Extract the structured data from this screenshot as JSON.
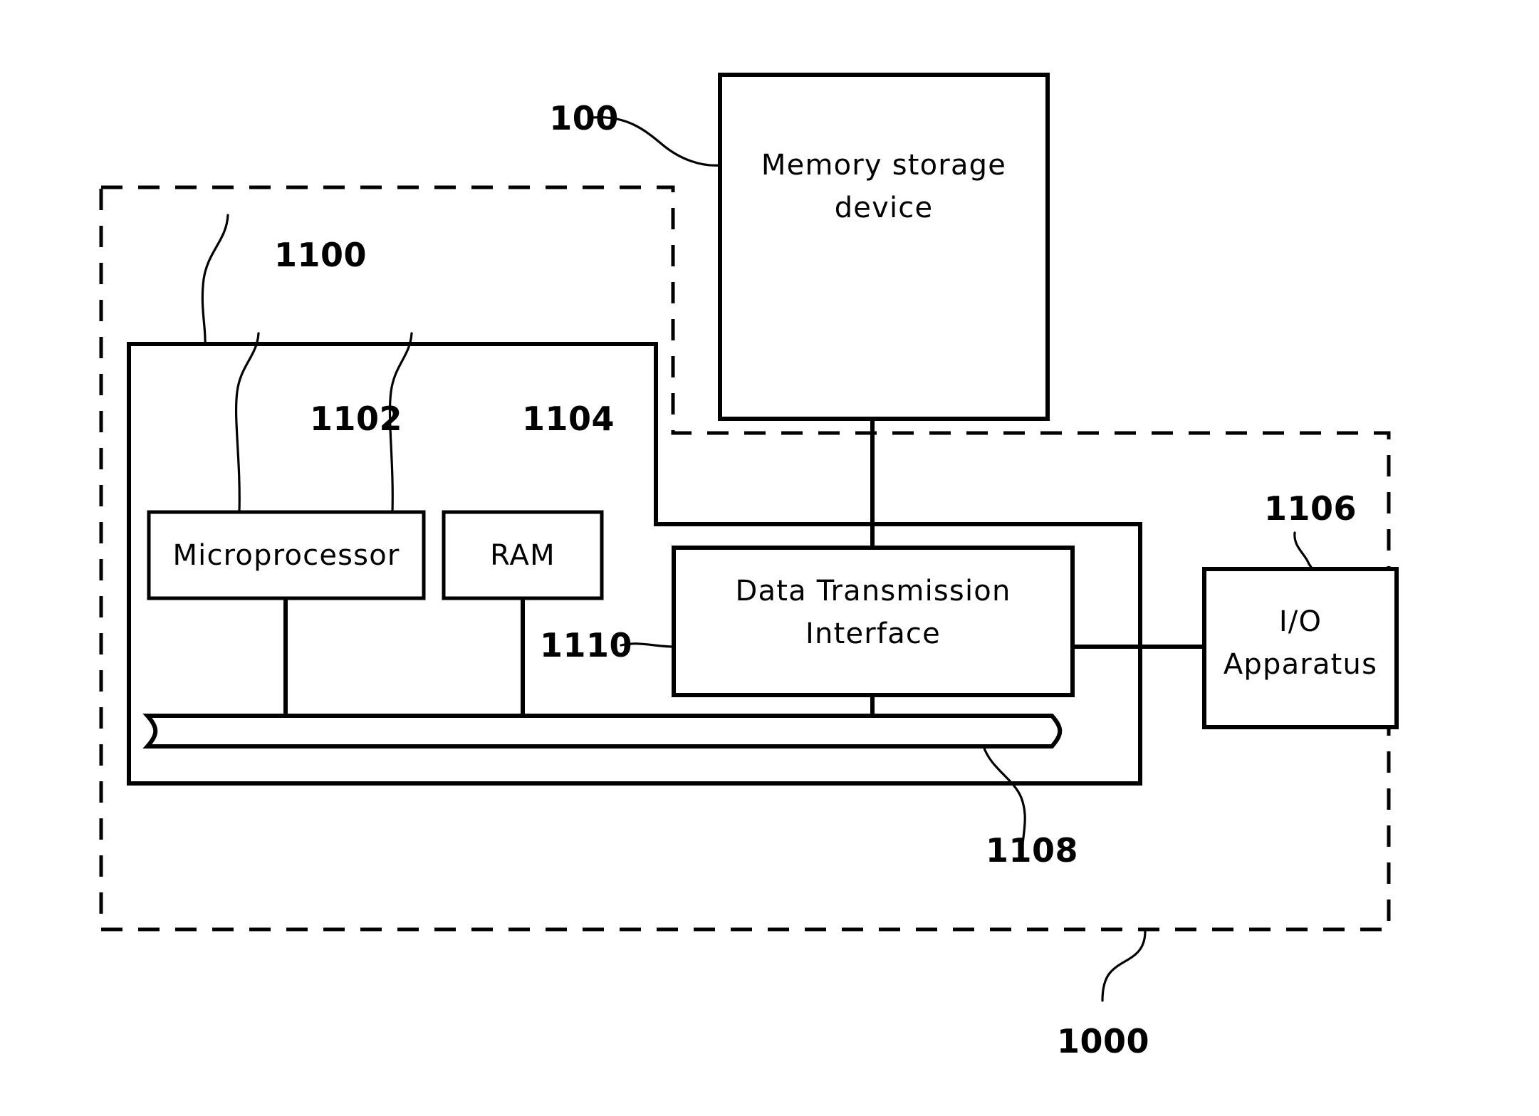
{
  "figure": {
    "type": "patent-block-diagram",
    "description": "Host system block diagram with memory storage device"
  },
  "blocks": {
    "memory_storage": {
      "label_line1": "Memory storage",
      "label_line2": "device",
      "ref": "100"
    },
    "host_system": {
      "ref": "1100"
    },
    "microprocessor": {
      "label": "Microprocessor",
      "ref": "1102"
    },
    "ram": {
      "label": "RAM",
      "ref": "1104"
    },
    "data_transmission_interface": {
      "label_line1": "Data Transmission",
      "label_line2": "Interface",
      "ref": "1110"
    },
    "io_apparatus": {
      "label_line1": "I/O",
      "label_line2": "Apparatus",
      "ref": "1106"
    },
    "system_bus": {
      "ref": "1108"
    },
    "outer_system": {
      "ref": "1000"
    }
  },
  "colors": {
    "line": "#000000",
    "fill": "#ffffff",
    "text": "#000000"
  }
}
